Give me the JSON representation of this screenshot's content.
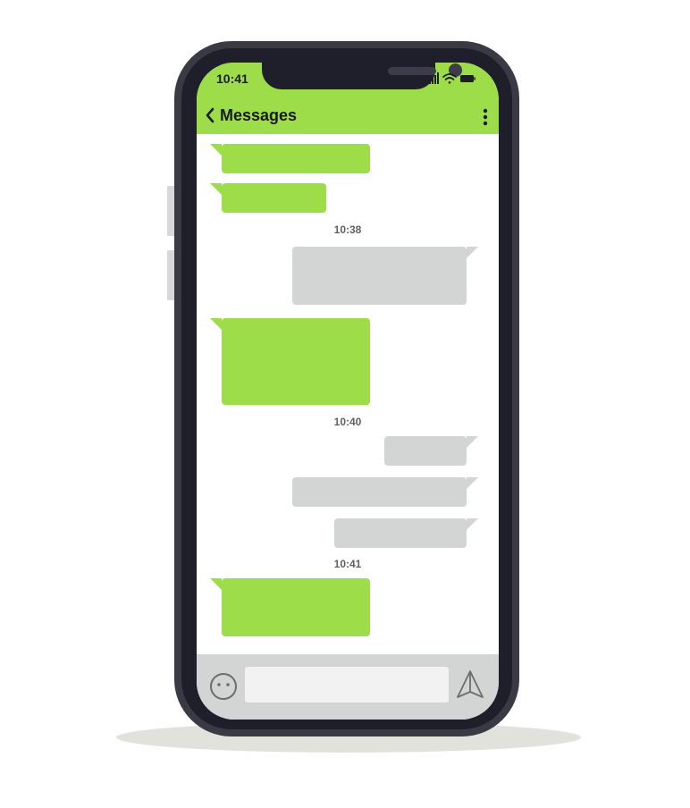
{
  "status_bar": {
    "time": "10:41",
    "icons": [
      "signal-icon",
      "wifi-icon",
      "battery-icon"
    ]
  },
  "header": {
    "back_icon": "chevron-left-icon",
    "title": "Messages",
    "menu_icon": "more-vertical-icon"
  },
  "conversation": {
    "timestamps": [
      "10:38",
      "10:40",
      "10:41"
    ],
    "messages": [
      {
        "direction": "incoming",
        "group": 1
      },
      {
        "direction": "incoming",
        "group": 1
      },
      {
        "direction": "outgoing",
        "group": 2
      },
      {
        "direction": "incoming",
        "group": 2
      },
      {
        "direction": "outgoing",
        "group": 3
      },
      {
        "direction": "outgoing",
        "group": 3
      },
      {
        "direction": "outgoing",
        "group": 3
      },
      {
        "direction": "incoming",
        "group": 4
      }
    ]
  },
  "composer": {
    "emoji_icon": "smiley-icon",
    "input_value": "",
    "input_placeholder": "",
    "send_icon": "paper-plane-icon"
  },
  "colors": {
    "accent": "#9edd4a",
    "incoming_bubble": "#9edd4a",
    "outgoing_bubble": "#d3d5d4",
    "phone_frame": "#3a3a44",
    "phone_bezel": "#1f1e2b"
  }
}
